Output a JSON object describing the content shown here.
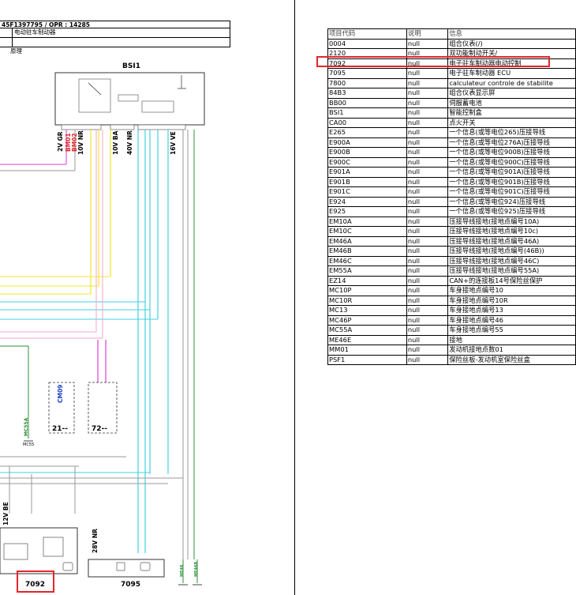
{
  "header": {
    "doc_ref": "45F1397795 / OPR : 14285",
    "row2_left": "",
    "row2_title": "电动驻车制动器",
    "row3_left": "",
    "row3_title": "",
    "principle": "原理"
  },
  "diagram": {
    "bsi_title": "BSI1",
    "bsi_connectors": [
      "2V GR",
      "10V NR",
      "10V BA",
      "40V NR",
      "16V VE"
    ],
    "bsi_pins_red": [
      "BM01",
      "BM02"
    ],
    "labels": {
      "cm09": "CM09",
      "box21": "21--",
      "box72": "72--",
      "mc55a": "MC55A",
      "mc55": "MC55",
      "c12v": "12V BE",
      "c28v": "28V NR",
      "ecu7092": "7092",
      "ecu7095": "7095",
      "me46": "ME46",
      "me46b": "ME46B"
    },
    "colors": {
      "yellow": "#f5e42a",
      "cyan": "#3fd1e3",
      "magenta": "#e23ad6",
      "pink": "#f2a6c9",
      "gray": "#9a9a9a",
      "green": "#2f8f3a",
      "highlight": "#e0262c"
    }
  },
  "table": {
    "headers": [
      "项目代码",
      "说明",
      "信息"
    ],
    "rows": [
      [
        "0004",
        "null",
        "组合仪表(/)"
      ],
      [
        "2120",
        "null",
        "双功能制动开关/"
      ],
      [
        "7092",
        "null",
        "电子驻车制动器电动控制"
      ],
      [
        "7095",
        "null",
        "电子驻车制动器 ECU"
      ],
      [
        "7800",
        "null",
        "calculateur controle de stabilite"
      ],
      [
        "84B3",
        "null",
        "组合仪表显示屏"
      ],
      [
        "BB00",
        "null",
        "伺服蓄电池"
      ],
      [
        "BSI1",
        "null",
        "智能控制盒"
      ],
      [
        "CA00",
        "null",
        "点火开关"
      ],
      [
        "E265",
        "null",
        "一个信息(或等电位265)压接导线"
      ],
      [
        "E900A",
        "null",
        "一个信息(或等电位276A)压接导线"
      ],
      [
        "E900B",
        "null",
        "一个信息(或等电位900B)压接导线"
      ],
      [
        "E900C",
        "null",
        "一个信息(或等电位900C)压接导线"
      ],
      [
        "E901A",
        "null",
        "一个信息(或等电位901A)压接导线"
      ],
      [
        "E901B",
        "null",
        "一个信息(或等电位901B)压接导线"
      ],
      [
        "E901C",
        "null",
        "一个信息(或等电位901C)压接导线"
      ],
      [
        "E924",
        "null",
        "一个信息(或等电位924)压接导线"
      ],
      [
        "E925",
        "null",
        "一个信息(或等电位925)压接导线"
      ],
      [
        "EM10A",
        "null",
        "压接导线接地(接地点编号10A)"
      ],
      [
        "EM10C",
        "null",
        "压接导线接地(接地点编号10c)"
      ],
      [
        "EM46A",
        "null",
        "压接导线接地(接地点编号46A)"
      ],
      [
        "EM46B",
        "null",
        "压接导线接地(接地点编号(46B))"
      ],
      [
        "EM46C",
        "null",
        "压接导线接地(接地点编号46C)"
      ],
      [
        "EM55A",
        "null",
        "压接导线接地(接地点编号55A)"
      ],
      [
        "EZ14",
        "null",
        "CAN+的连接板14号保险丝保护"
      ],
      [
        "MC10P",
        "null",
        "车身接地点编号10"
      ],
      [
        "MC10R",
        "null",
        "车身接地点编号10R"
      ],
      [
        "MC13",
        "null",
        "车身接地点编号13"
      ],
      [
        "MC46P",
        "null",
        "车身接地点编号46"
      ],
      [
        "MC55A",
        "null",
        "车身接地点编号55"
      ],
      [
        "ME46E",
        "null",
        "接地"
      ],
      [
        "MM01",
        "null",
        "发动机接地点数01"
      ],
      [
        "PSF1",
        "null",
        "保险丝板-发动机室保险丝盒"
      ]
    ]
  }
}
